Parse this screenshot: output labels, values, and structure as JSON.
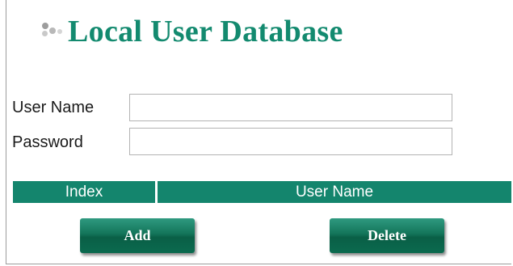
{
  "page": {
    "title": "Local User Database"
  },
  "form": {
    "user_name": {
      "label": "User Name",
      "value": "",
      "placeholder": ""
    },
    "password": {
      "label": "Password",
      "value": "",
      "placeholder": ""
    }
  },
  "table": {
    "columns": [
      "Index",
      "User Name"
    ],
    "rows": []
  },
  "buttons": {
    "add_label": "Add",
    "delete_label": "Delete"
  },
  "colors": {
    "accent": "#138a6f",
    "header_bg": "#14856d",
    "button_bg": "#0b6a4f"
  },
  "icons": {
    "title_decoration": "dots-icon"
  }
}
